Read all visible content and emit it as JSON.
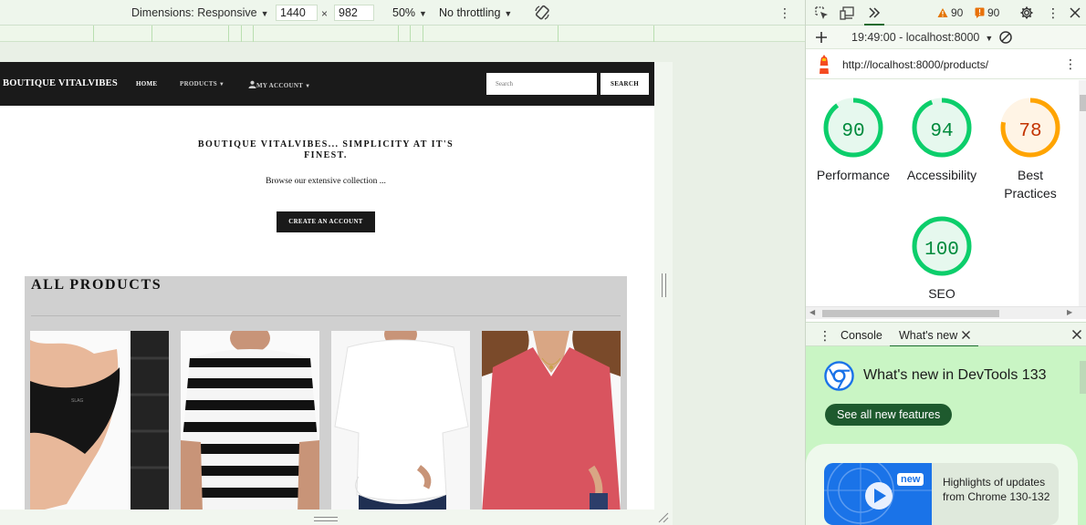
{
  "device_toolbar": {
    "dimensions_label": "Dimensions: Responsive",
    "width_value": "1440",
    "height_value": "982",
    "times": "×",
    "zoom": "50%",
    "throttling": "No throttling"
  },
  "site": {
    "brand": "BOUTIQUE VITALVIBES",
    "nav": {
      "home": "HOME",
      "products": "PRODUCTS",
      "account": "MY ACCOUNT"
    },
    "search_placeholder": "Search",
    "search_button": "SEARCH",
    "hero_title": "BOUTIQUE VITALVIBES... SIMPLICITY AT IT'S FINEST.",
    "hero_subtitle": "Browse our extensive collection ...",
    "hero_button": "CREATE AN ACCOUNT",
    "products_heading": "ALL PRODUCTS",
    "products_preview_note": "",
    "product_cards": [
      {
        "name": "black-briefs",
        "color": "#1c1c1c"
      },
      {
        "name": "striped-tshirt",
        "color": "#1a1a1a"
      },
      {
        "name": "white-oversized-tshirt",
        "color": "#f2f2f2"
      },
      {
        "name": "pink-vneck-top",
        "color": "#d9545f"
      }
    ]
  },
  "devtools": {
    "warnings": "90",
    "errors": "90",
    "timestamp": "19:49:00 - localhost:8000",
    "url": "http://localhost:8000/products/",
    "scores": [
      {
        "label": "Performance",
        "value": "90",
        "fraction": 0.9,
        "color": "#0cce6b",
        "text_color": "#008a3c",
        "bg": "#e6f8ee"
      },
      {
        "label": "Accessibility",
        "value": "94",
        "fraction": 0.94,
        "color": "#0cce6b",
        "text_color": "#008a3c",
        "bg": "#e6f8ee"
      },
      {
        "label": "Best Practices",
        "value": "78",
        "fraction": 0.78,
        "color": "#ffa400",
        "text_color": "#c33300",
        "bg": "#fff4e5"
      },
      {
        "label": "SEO",
        "value": "100",
        "fraction": 1.0,
        "color": "#0cce6b",
        "text_color": "#008a3c",
        "bg": "#e6f8ee"
      }
    ],
    "drawer": {
      "console_tab": "Console",
      "whats_new_tab": "What's new",
      "whats_new_title": "What's new in DevTools 133",
      "see_all_button": "See all new features",
      "new_badge": "new",
      "card_text": "Highlights of updates from Chrome 130-132"
    }
  },
  "colors": {
    "toolbar_bg": "#eef6ec",
    "site_nav_bg": "#1a1a1a",
    "products_bg": "#d0d0d0",
    "whats_new_bg": "#c9f5c4",
    "accent_green": "#1e5a2e"
  }
}
